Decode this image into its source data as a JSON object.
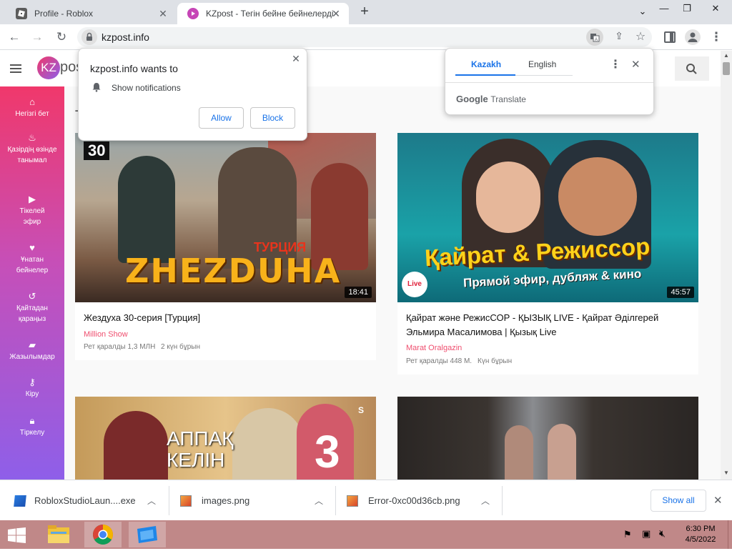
{
  "browser": {
    "tabs": [
      {
        "title": "Profile - Roblox",
        "active": false
      },
      {
        "title": "KZpost - Тегін бейне бейнелерді",
        "active": true
      }
    ],
    "new_tab_label": "+",
    "url": "kzpost.info"
  },
  "site": {
    "logo_badge": "KZ",
    "logo_text": "pos",
    "sidebar": [
      {
        "label": "Негізгі бет",
        "icon": "home-icon"
      },
      {
        "label": "Қазірдің өзінде танымал",
        "icon": "fire-icon"
      },
      {
        "label": "Тікелей эфир",
        "icon": "play-icon"
      },
      {
        "label": "Ұнатан бейнелер",
        "icon": "heart-icon"
      },
      {
        "label": "Қайтадан қараңыз",
        "icon": "history-icon"
      },
      {
        "label": "Жазылымдар",
        "icon": "folder-icon"
      },
      {
        "label": "Кіру",
        "icon": "key-icon"
      },
      {
        "label": "Тіркелу",
        "icon": "lock-icon"
      }
    ],
    "section_heading": "T",
    "videos": [
      {
        "thumb_badge": "30",
        "thumb_title": "ZHEZDUHA",
        "thumb_sub": "ТУРЦИЯ",
        "duration": "18:41",
        "title": "Жездуха 30-серия [Турция]",
        "channel": "Million Show",
        "views": "Рет қаралды 1,3 МЛН",
        "age": "2 күн бұрын"
      },
      {
        "thumb_title": "Қайрат & Режиссор",
        "thumb_sub": "Прямой эфир, дубляж & кино",
        "thumb_badge": "Live",
        "duration": "45:57",
        "title": "Қайрат және РежисСОР - ҚЫЗЫҚ LIVE - Қайрат Әділгерей Эльмира Масалимова | Қызық Live",
        "channel": "Marat Oralgazin",
        "views": "Рет қаралды 448 М.",
        "age": "Күн бұрын"
      },
      {
        "thumb_title": "АППАҚ КЕЛІН",
        "thumb_badge": "3",
        "thumb_corner": "S"
      },
      {}
    ]
  },
  "notification_prompt": {
    "heading": "kzpost.info wants to",
    "item": "Show notifications",
    "allow": "Allow",
    "block": "Block"
  },
  "translate": {
    "tabs": [
      "Kazakh",
      "English"
    ],
    "brand_google": "Google",
    "brand_translate": "Translate"
  },
  "downloads": {
    "items": [
      "RobloxStudioLaun....exe",
      "images.png",
      "Error-0xc00d36cb.png"
    ],
    "show_all": "Show all"
  },
  "taskbar": {
    "time": "6:30 PM",
    "date": "4/5/2022"
  }
}
